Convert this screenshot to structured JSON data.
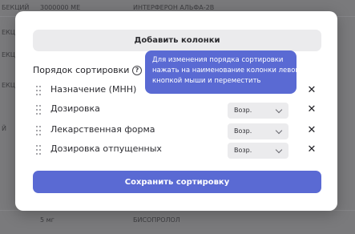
{
  "background": {
    "cells": [
      {
        "text": "БЕКЦИЙ"
      },
      {
        "text": "3000000 МЕ"
      },
      {
        "text": "ИНТЕРФЕРОН АЛЬФА-2В"
      },
      {
        "text": "ЕКЦИЙ"
      },
      {
        "text": "ЕКЦИЙ"
      },
      {
        "text": "ЕКЦИЙ"
      },
      {
        "text": "Й"
      },
      {
        "text": "5 мг"
      },
      {
        "text": "БИСОПРОЛОЛ"
      }
    ]
  },
  "modal": {
    "add_columns_label": "Добавить колонки",
    "sort_title": "Порядок сортировки",
    "help_glyph": "?",
    "tooltip_lines": [
      "Для изменения порядка сортировки",
      "нажать на наименование колонки левой",
      "кнопкой мыши и переместить"
    ],
    "rows": [
      {
        "label": "Назначение (МНН)",
        "order": "Возр.",
        "show_select": false
      },
      {
        "label": "Дозировка",
        "order": "Возр.",
        "show_select": true
      },
      {
        "label": "Лекарственная форма",
        "order": "Возр.",
        "show_select": true
      },
      {
        "label": "Дозировка отпущенных",
        "order": "Возр.",
        "show_select": true
      }
    ],
    "remove_glyph": "✕",
    "save_label": "Сохранить сортировку"
  },
  "colors": {
    "accent": "#5a6ad3",
    "secondary_button": "#ebebed",
    "overlay": "#6f6f71"
  }
}
